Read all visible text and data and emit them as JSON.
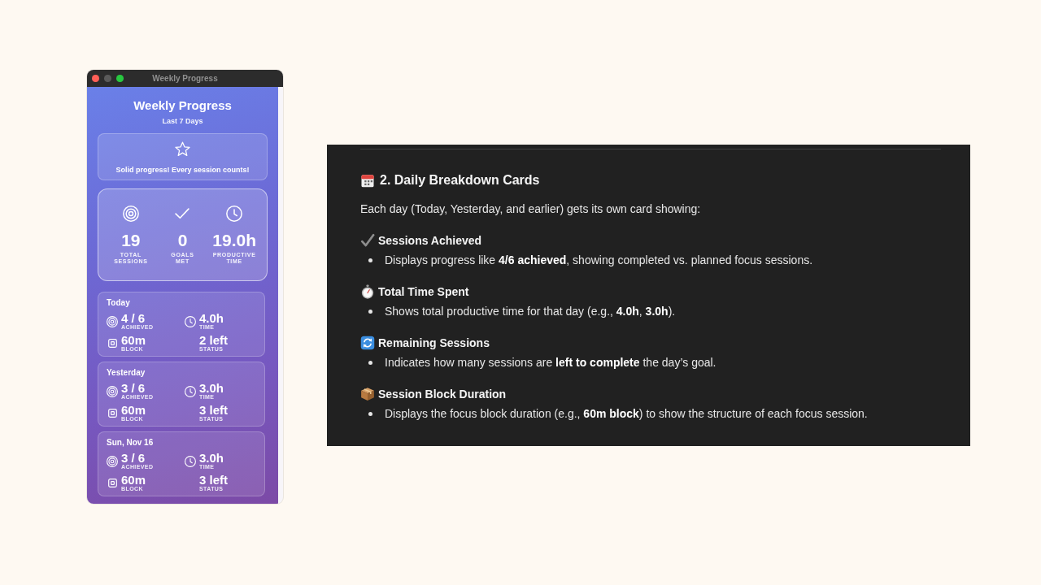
{
  "window": {
    "title": "Weekly Progress",
    "controls": [
      {
        "kind": "close",
        "disabled": false
      },
      {
        "kind": "minimize",
        "disabled": true
      },
      {
        "kind": "zoom",
        "disabled": false
      }
    ]
  },
  "app": {
    "title": "Weekly Progress",
    "subtitle": "Last 7 Days",
    "message": "Solid progress! Every session counts!",
    "stats": [
      {
        "kind": "sessions",
        "value": "19",
        "label": "TOTAL SESSIONS"
      },
      {
        "kind": "goals",
        "value": "0",
        "label": "GOALS MET"
      },
      {
        "kind": "time",
        "value": "19.0h",
        "label": "PRODUCTIVE TIME"
      }
    ],
    "days": [
      {
        "title": "Today",
        "metrics": [
          {
            "kind": "achieved",
            "value": "4 / 6",
            "label": "ACHIEVED"
          },
          {
            "kind": "time",
            "value": "4.0h",
            "label": "TIME"
          },
          {
            "kind": "block",
            "value": "60m",
            "label": "BLOCK"
          },
          {
            "kind": "status",
            "value": "2 left",
            "label": "STATUS"
          }
        ]
      },
      {
        "title": "Yesterday",
        "metrics": [
          {
            "kind": "achieved",
            "value": "3 / 6",
            "label": "ACHIEVED"
          },
          {
            "kind": "time",
            "value": "3.0h",
            "label": "TIME"
          },
          {
            "kind": "block",
            "value": "60m",
            "label": "BLOCK"
          },
          {
            "kind": "status",
            "value": "3 left",
            "label": "STATUS"
          }
        ]
      },
      {
        "title": "Sun, Nov 16",
        "metrics": [
          {
            "kind": "achieved",
            "value": "3 / 6",
            "label": "ACHIEVED"
          },
          {
            "kind": "time",
            "value": "3.0h",
            "label": "TIME"
          },
          {
            "kind": "block",
            "value": "60m",
            "label": "BLOCK"
          },
          {
            "kind": "status",
            "value": "3 left",
            "label": "STATUS"
          }
        ]
      }
    ]
  },
  "document": {
    "heading": "2. Daily Breakdown Cards",
    "intro": "Each day (Today, Yesterday, and earlier) gets its own card showing:",
    "sections": [
      {
        "kind": "achieved",
        "title": "Sessions Achieved",
        "bullets": [
          "Displays progress like **4/6 achieved**, showing completed vs. planned focus sessions."
        ]
      },
      {
        "kind": "time",
        "title": "Total Time Spent",
        "bullets": [
          "Shows total productive time for that day (e.g., **4.0h**, **3.0h**)."
        ]
      },
      {
        "kind": "remaining",
        "title": "Remaining Sessions",
        "bullets": [
          "Indicates how many sessions are **left to complete** the day’s goal."
        ]
      },
      {
        "kind": "block",
        "title": "Session Block Duration",
        "bullets": [
          "Displays the focus block duration (e.g., **60m block**) to show the structure of each focus session."
        ]
      }
    ]
  }
}
